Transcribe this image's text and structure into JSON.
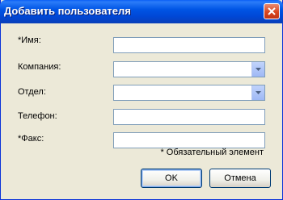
{
  "window": {
    "title": "Добавить пользователя"
  },
  "form": {
    "name_label": "*Имя:",
    "company_label": "Компания:",
    "department_label": "Отдел:",
    "phone_label": "Телефон:",
    "fax_label": "*Факс:",
    "name_value": "",
    "company_value": "",
    "department_value": "",
    "phone_value": "",
    "fax_value": ""
  },
  "note": "* Обязательный элемент",
  "buttons": {
    "ok_label": "OK",
    "cancel_label": "Отмена"
  },
  "colors": {
    "titlebar": "#0055e5",
    "close_button": "#d9461f",
    "dialog_bg": "#ece9d8",
    "field_border": "#7f9db9"
  }
}
